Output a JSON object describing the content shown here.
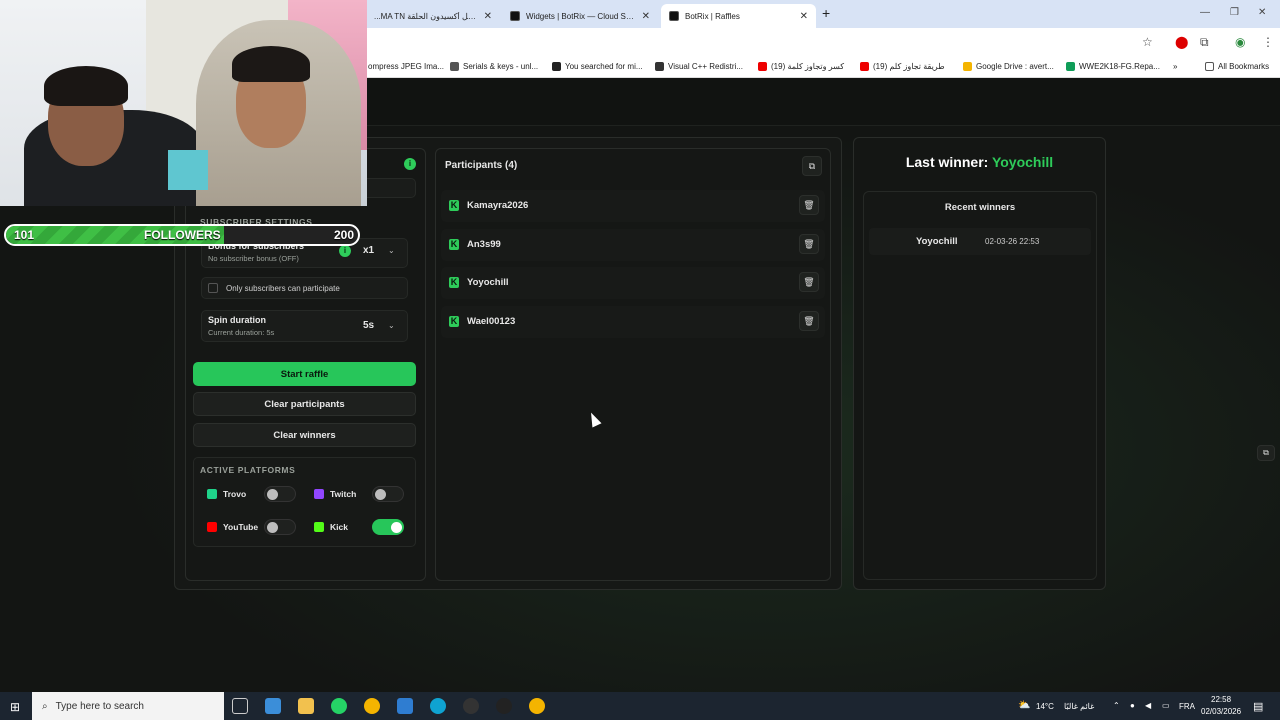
{
  "browser": {
    "tabs": [
      {
        "title": "...MA TN مسلسل أكسيدون الحلقة",
        "active": false
      },
      {
        "title": "Widgets | BotRix — Cloud Strea",
        "active": false
      },
      {
        "title": "BotRix | Raffles",
        "active": true
      }
    ],
    "new_tab": "+",
    "bookmarks": [
      "ompress JPEG Ima...",
      "Serials & keys - unl...",
      "You searched for mi...",
      "Visual C++ Redistri...",
      "كسر وتجاوز كلمة (19)",
      "طريقة تجاوز كلم (19)",
      "Google Drive : avert...",
      "WWE2K18-FG.Repa..."
    ],
    "bookmarks_more": "»",
    "all_bookmarks": "All Bookmarks"
  },
  "settings": {
    "subscriber_section_label": "SUBSCRIBER SETTINGS",
    "bonus_title": "Bonus for subscribers",
    "bonus_sub": "No subscriber bonus (OFF)",
    "bonus_value": "x1",
    "only_subscribers_label": "Only subscribers can participate",
    "spin_title": "Spin duration",
    "spin_sub": "Current duration: 5s",
    "spin_value": "5s",
    "start_button": "Start raffle",
    "clear_participants_button": "Clear participants",
    "clear_winners_button": "Clear winners",
    "platforms_label": "ACTIVE PLATFORMS",
    "platforms": [
      {
        "name": "Trovo",
        "enabled": false,
        "color": "#1fd38a"
      },
      {
        "name": "Twitch",
        "enabled": false,
        "color": "#9146ff"
      },
      {
        "name": "YouTube",
        "enabled": false,
        "color": "#ff0000"
      },
      {
        "name": "Kick",
        "enabled": true,
        "color": "#53fc18"
      }
    ]
  },
  "participants": {
    "title": "Participants (4)",
    "list": [
      "Kamayra2026",
      "An3s99",
      "Yoyochill",
      "Wael00123"
    ]
  },
  "winner": {
    "label": "Last winner:",
    "name": "Yoyochill",
    "recent_title": "Recent winners",
    "recent": [
      {
        "name": "Yoyochill",
        "date": "02-03-26 22:53"
      }
    ]
  },
  "overlay": {
    "followers_start": "101",
    "followers_label": "FOLLOWERS",
    "followers_goal": "200",
    "progress": 0.62
  },
  "taskbar": {
    "search_placeholder": "Type here to search",
    "weather": "14°C",
    "weather_text": "غائم غالبًا",
    "lang": "FRA",
    "time": "22:58",
    "date": "02/03/2026"
  },
  "colors": {
    "accent": "#27c65a",
    "winner_name": "#2ecc5a"
  }
}
